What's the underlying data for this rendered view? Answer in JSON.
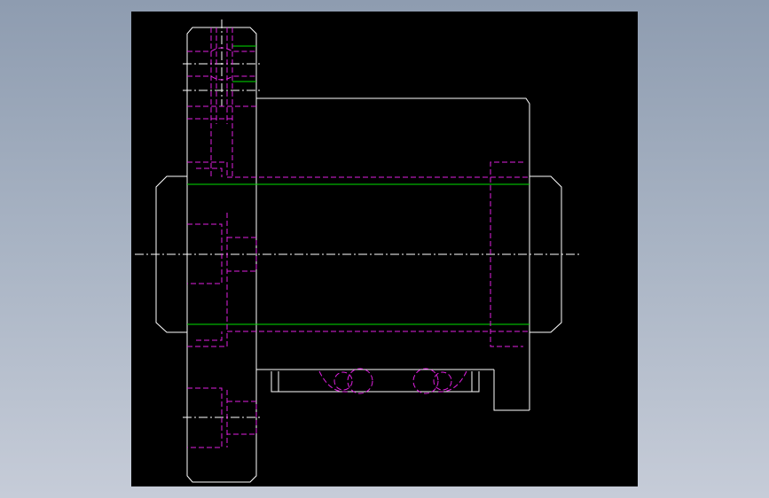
{
  "colors": {
    "background_gradient_top": "#8e9cb0",
    "background_gradient_bottom": "#c6ccd8",
    "viewport": "#000000",
    "outline": "#ffffff",
    "hidden_line": "#e020e0",
    "thread_line": "#00e000",
    "center_line": "#ffffff"
  },
  "viewport": {
    "name": "cad-model-viewport",
    "label": ""
  }
}
